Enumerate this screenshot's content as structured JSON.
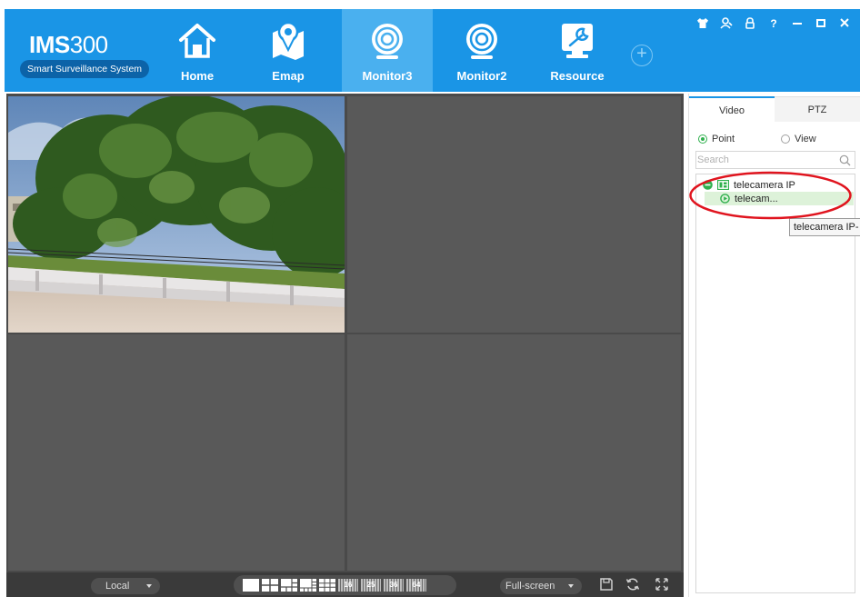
{
  "app": {
    "logo_title_bold": "IMS",
    "logo_title_num": "300",
    "logo_subtitle": "Smart Surveillance System"
  },
  "nav": {
    "tabs": [
      {
        "label": "Home",
        "icon": "home-icon"
      },
      {
        "label": "Emap",
        "icon": "map-pin-icon"
      },
      {
        "label": "Monitor3",
        "icon": "camera-lens-icon",
        "active": true
      },
      {
        "label": "Monitor2",
        "icon": "camera-lens-icon"
      },
      {
        "label": "Resource",
        "icon": "wrench-icon"
      }
    ],
    "add_tab": "+"
  },
  "window_controls": {
    "help": "?"
  },
  "toolbar": {
    "stream": "Local",
    "layouts": [
      "1",
      "4",
      "6",
      "8",
      "9",
      "16",
      "25",
      "36",
      "64"
    ],
    "layout_16": "16",
    "layout_25": "25",
    "layout_36": "36",
    "layout_64": "64",
    "fullscreen": "Full-screen"
  },
  "right_panel": {
    "tab_video": "Video",
    "tab_ptz": "PTZ",
    "radio_point": "Point",
    "radio_view": "View",
    "search_placeholder": "Search",
    "tree": {
      "group_label": "telecamera IP",
      "camera_label": "telecam..."
    },
    "tooltip": "telecamera IP-"
  },
  "colors": {
    "header": "#1a95e6",
    "active_tab": "#4ab0ef",
    "video_background": "#595959",
    "accent_green": "#2fb04d",
    "annotation": "#e0141e"
  }
}
